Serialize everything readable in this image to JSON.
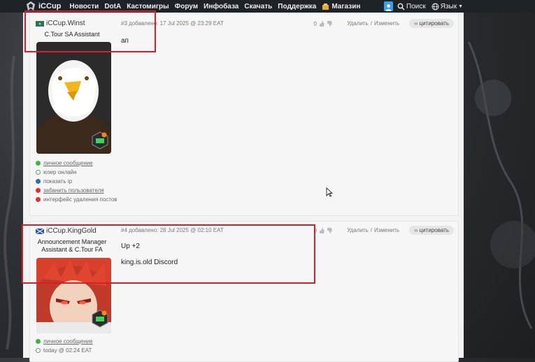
{
  "brand": {
    "name": "iCCup"
  },
  "nav": {
    "items": [
      "Новости",
      "DotA",
      "Кастомигры",
      "Форум",
      "Инфобаза",
      "Скачать",
      "Поддержка"
    ],
    "shop": "Магазин",
    "search": "Поиск",
    "language": "Язык"
  },
  "posts": [
    {
      "author": "iCCup.Winst",
      "role": "C.Tour SA Assistant",
      "meta": "#3 добавлено: 17 Jul 2025 @ 23:29 EAT",
      "score": "0",
      "delete": "Удалить",
      "edit": "Изменить",
      "quote": "›› цитировать",
      "body": [
        "ап"
      ],
      "actions": [
        "личное сообщение",
        "юзер онлайн",
        "показать ip",
        "забанить пользователя",
        "интерфейс удаления постов"
      ]
    },
    {
      "author": "iCCup.KingGold",
      "role_line1": "Announcement Manager",
      "role_line2": "Assistant & C.Tour FA",
      "meta": "#4 добавлено: 28 Jul 2025 @ 02:10 EAT",
      "score": "0",
      "delete": "Удалить",
      "edit": "Изменить",
      "quote": "›› цитировать",
      "body": [
        "Up +2",
        "king.is.old Discord"
      ],
      "actions": [
        "личное сообщение",
        "today @ 02:24 EAT"
      ]
    }
  ],
  "colors": {
    "highlight": "#d4202c",
    "online": "#3cb44b",
    "ban": "#e03030",
    "link": "#555555"
  }
}
